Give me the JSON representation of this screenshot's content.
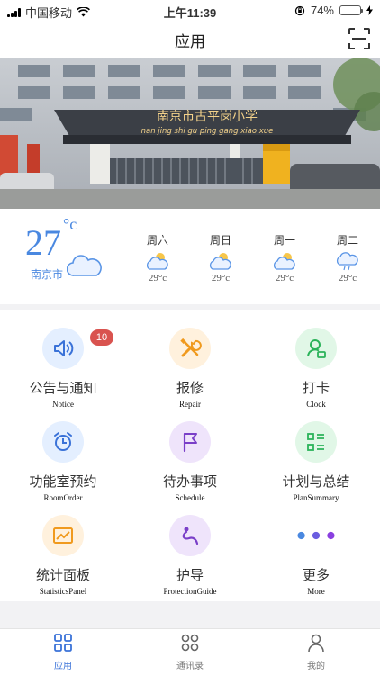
{
  "status": {
    "carrier": "中国移动",
    "time": "上午11:39",
    "battery": "74%",
    "battery_level": 0.74
  },
  "header": {
    "title": "应用"
  },
  "banner": {
    "sign_cn": "南京市古平岗小学",
    "sign_pinyin": "nan jing shi gu ping gang xiao xue"
  },
  "weather": {
    "temperature": "27",
    "unit": "°c",
    "city": "南京市",
    "forecast": [
      {
        "day": "周六",
        "temp": "29°c",
        "icon": "sun-cloud-icon"
      },
      {
        "day": "周日",
        "temp": "29°c",
        "icon": "sun-cloud-icon"
      },
      {
        "day": "周一",
        "temp": "29°c",
        "icon": "sun-cloud-icon"
      },
      {
        "day": "周二",
        "temp": "29°c",
        "icon": "rain-cloud-icon"
      }
    ]
  },
  "apps": [
    {
      "label": "公告与通知",
      "sub": "Notice",
      "icon": "speaker-icon",
      "badge": "10"
    },
    {
      "label": "报修",
      "sub": "Repair",
      "icon": "tools-icon"
    },
    {
      "label": "打卡",
      "sub": "Clock",
      "icon": "user-card-icon"
    },
    {
      "label": "功能室预约",
      "sub": "RoomOrder",
      "icon": "alarm-clock-icon"
    },
    {
      "label": "待办事项",
      "sub": "Schedule",
      "icon": "flag-icon"
    },
    {
      "label": "计划与总结",
      "sub": "PlanSummary",
      "icon": "list-icon"
    },
    {
      "label": "统计面板",
      "sub": "StatisticsPanel",
      "icon": "chart-icon"
    },
    {
      "label": "护导",
      "sub": "ProtectionGuide",
      "icon": "route-icon"
    },
    {
      "label": "更多",
      "sub": "More",
      "icon": "more-dots-icon"
    }
  ],
  "tabs": [
    {
      "label": "应用",
      "icon": "apps-grid-icon",
      "active": true
    },
    {
      "label": "通讯录",
      "icon": "contacts-icon",
      "active": false
    },
    {
      "label": "我的",
      "icon": "person-icon",
      "active": false
    }
  ],
  "colors": {
    "accent": "#3a72d8",
    "badge": "#d9534f"
  }
}
